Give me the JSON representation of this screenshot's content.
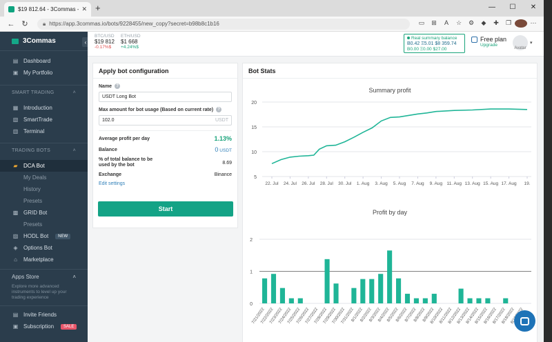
{
  "browser": {
    "tab_title": "$19 812.64 - 3Commas - Crypto",
    "new_tab": "+",
    "url": "https://app.3commas.io/bots/9228455/new_copy?secret=b98b8c1b16",
    "win_min": "—",
    "win_max": "☐",
    "win_close": "✕"
  },
  "sidebar": {
    "brand": "3Commas",
    "collapse": "‹",
    "top_items": [
      {
        "label": "Dashboard",
        "icon": "dashboard-icon"
      },
      {
        "label": "My Portfolio",
        "icon": "portfolio-icon"
      }
    ],
    "smart_trading": {
      "title": "SMART TRADING",
      "items": [
        {
          "label": "Introduction"
        },
        {
          "label": "SmartTrade"
        },
        {
          "label": "Terminal"
        }
      ]
    },
    "trading_bots": {
      "title": "TRADING BOTS",
      "items": [
        {
          "label": "DCA Bot"
        },
        {
          "label": "My Deals"
        },
        {
          "label": "History"
        },
        {
          "label": "Presets"
        },
        {
          "label": "GRID Bot"
        },
        {
          "label": "Presets"
        },
        {
          "label": "HODL Bot",
          "badge": "NEW"
        },
        {
          "label": "Options Bot"
        },
        {
          "label": "Marketplace"
        }
      ]
    },
    "apps_store": {
      "title": "Apps Store",
      "desc": "Explore more advanced instruments to level up your trading experience"
    },
    "bottom_items": [
      {
        "label": "Invite Friends"
      },
      {
        "label": "Subscription",
        "badge": "SALE"
      }
    ]
  },
  "header": {
    "btc": {
      "label": "BTC/USD",
      "value": "$19 812",
      "change": "-0.17%$"
    },
    "eth": {
      "label": "ETH/USD",
      "value": "$1 668",
      "change": "+4.24%$"
    },
    "balance": {
      "title": "Real summary balance",
      "line1": "B0.42  Ξ5.01  $8 359.74",
      "line2": "B0.00  Ξ0.00  $27.00"
    },
    "plan": {
      "name": "Free plan",
      "upgrade": "Upgrade"
    },
    "avatar_alt": "Avatar"
  },
  "config": {
    "title": "Apply bot configuration",
    "name_label": "Name",
    "name_value": "USDT Long Bot",
    "max_label": "Max amount for bot usage (Based on current rate)",
    "max_value": "102.0",
    "max_unit": "USDT",
    "avg_label": "Average profit per day",
    "avg_value": "1.13%",
    "balance_label": "Balance",
    "balance_value": "0",
    "balance_unit": "USDT",
    "pct_label": "% of total balance to be used by the bot",
    "pct_value": "8.69",
    "exchange_label": "Exchange",
    "exchange_value": "Binance",
    "edit_link": "Edit settings",
    "start": "Start"
  },
  "stats": {
    "title": "Bot Stats"
  },
  "chart_data": [
    {
      "type": "line",
      "title": "Summary profit",
      "x": [
        "22. Jul",
        "24. Jul",
        "26. Jul",
        "28. Jul",
        "30. Jul",
        "1. Aug",
        "3. Aug",
        "5. Aug",
        "7. Aug",
        "9. Aug",
        "11. Aug",
        "13. Aug",
        "15. Aug",
        "17. Aug",
        "19."
      ],
      "ylim": [
        5,
        20
      ],
      "yticks": [
        5,
        10,
        15,
        20
      ],
      "color": "#1fb597",
      "points": [
        [
          0,
          7.6
        ],
        [
          0.5,
          8.4
        ],
        [
          1,
          8.9
        ],
        [
          1.5,
          9.1
        ],
        [
          2,
          9.2
        ],
        [
          2.3,
          9.3
        ],
        [
          2.6,
          10.5
        ],
        [
          3,
          11.2
        ],
        [
          3.5,
          11.3
        ],
        [
          4,
          12.0
        ],
        [
          4.5,
          12.9
        ],
        [
          5,
          13.9
        ],
        [
          5.5,
          14.8
        ],
        [
          6,
          16.2
        ],
        [
          6.5,
          16.9
        ],
        [
          7,
          17.0
        ],
        [
          7.5,
          17.3
        ],
        [
          8,
          17.6
        ],
        [
          8.5,
          17.8
        ],
        [
          9,
          18.1
        ],
        [
          10,
          18.3
        ],
        [
          11,
          18.4
        ],
        [
          12,
          18.6
        ],
        [
          13,
          18.6
        ],
        [
          14,
          18.5
        ]
      ]
    },
    {
      "type": "bar",
      "title": "Profit by day",
      "ylim": [
        0,
        2
      ],
      "yticks": [
        0,
        1,
        2
      ],
      "color": "#1fb597",
      "categories": [
        "7/21/2022",
        "7/22/2022",
        "7/23/2022",
        "7/24/2022",
        "7/25/2022",
        "7/26/2022",
        "7/27/2022",
        "7/28/2022",
        "7/29/2022",
        "7/30/2022",
        "7/31/2022",
        "8/1/2022",
        "8/2/2022",
        "8/3/2022",
        "8/4/2022",
        "8/5/2022",
        "8/6/2022",
        "8/7/2022",
        "8/8/2022",
        "8/9/2022",
        "8/10/2022",
        "8/11/2022",
        "8/12/2022",
        "8/13/2022",
        "8/14/2022",
        "8/15/2022",
        "8/16/2022",
        "8/17/2022",
        "8/18/2022",
        "8/19/2022"
      ],
      "values": [
        0.78,
        0.92,
        0.48,
        0.16,
        0.16,
        0,
        0,
        1.38,
        0.62,
        0,
        0.48,
        0.76,
        0.76,
        0.92,
        1.65,
        0.78,
        0.3,
        0.16,
        0.16,
        0.3,
        0,
        0,
        0.46,
        0.16,
        0.16,
        0.16,
        0,
        0.16,
        0,
        0
      ]
    }
  ]
}
